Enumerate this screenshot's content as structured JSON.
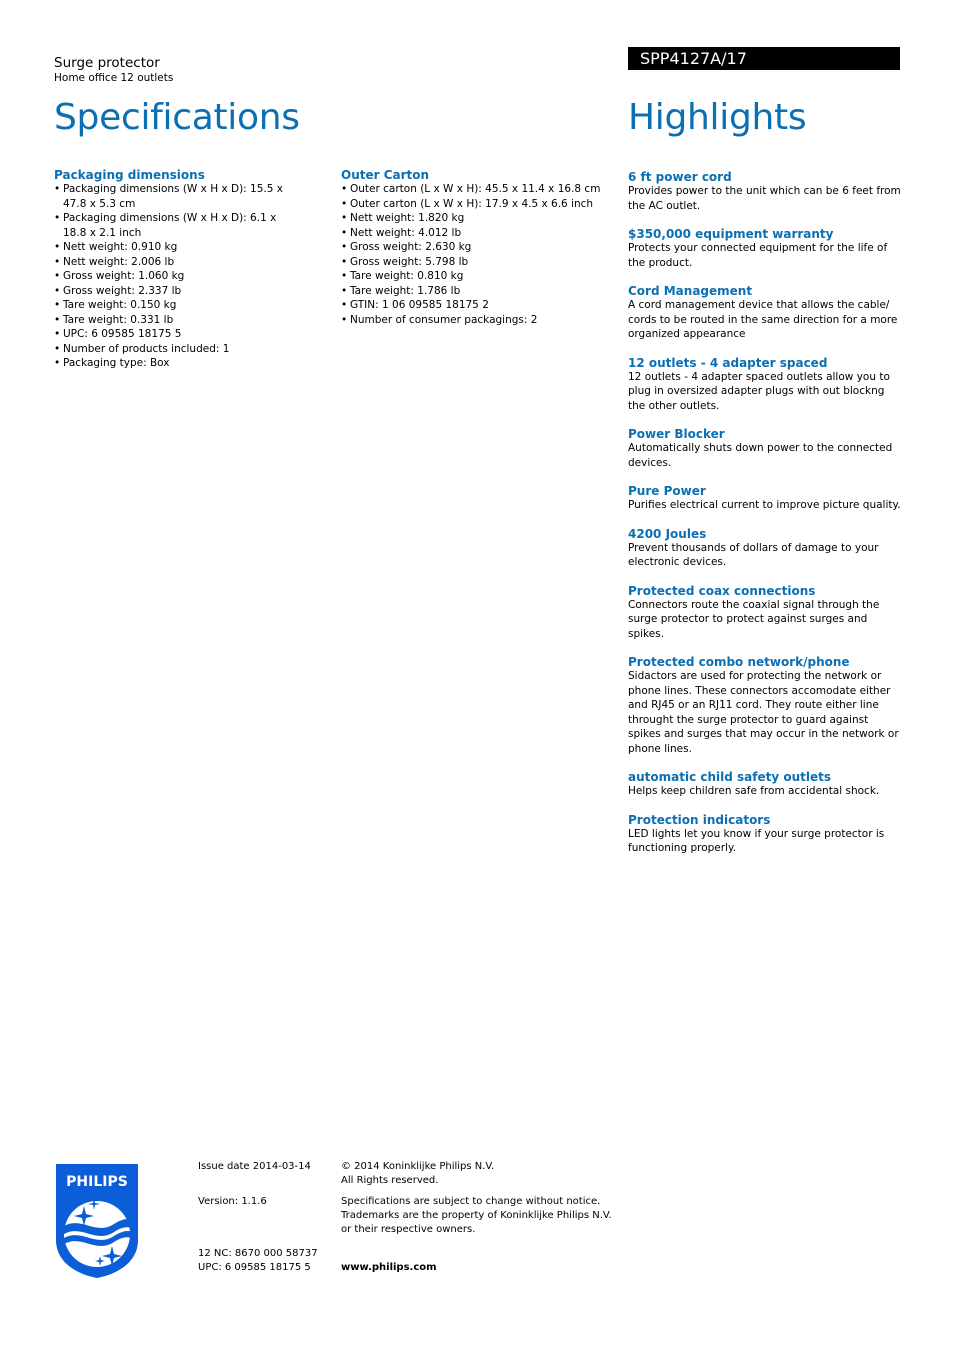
{
  "header": {
    "product_name": "Surge protector",
    "product_sub": "Home office 12 outlets",
    "model": "SPP4127A/17",
    "spec_title": "Specifications",
    "highlights_title": "Highlights"
  },
  "colors": {
    "accent": "#0b6fb3",
    "model_bar": "#000000"
  },
  "specs": {
    "packaging": {
      "title": "Packaging dimensions",
      "items": [
        "Packaging dimensions (W x H x D): 15.5 x 47.8 x 5.3 cm",
        "Packaging dimensions (W x H x D): 6.1 x 18.8 x 2.1 inch",
        "Nett weight: 0.910 kg",
        "Nett weight: 2.006 lb",
        "Gross weight: 1.060 kg",
        "Gross weight: 2.337 lb",
        "Tare weight: 0.150 kg",
        "Tare weight: 0.331 lb",
        "UPC: 6 09585 18175 5",
        "Number of products included: 1",
        "Packaging type: Box"
      ]
    },
    "outer_carton": {
      "title": "Outer Carton",
      "items": [
        "Outer carton (L x W x H): 45.5 x 11.4 x 16.8 cm",
        "Outer carton (L x W x H): 17.9 x 4.5 x 6.6 inch",
        "Nett weight: 1.820 kg",
        "Nett weight: 4.012 lb",
        "Gross weight: 2.630 kg",
        "Gross weight: 5.798 lb",
        "Tare weight: 0.810 kg",
        "Tare weight: 1.786 lb",
        "GTIN: 1 06 09585 18175 2",
        "Number of consumer packagings: 2"
      ]
    }
  },
  "highlights": [
    {
      "title": "6 ft power cord",
      "desc": "Provides power to the unit which can be 6 feet from the AC outlet."
    },
    {
      "title": "$350,000 equipment warranty",
      "desc": "Protects your connected equipment for the life of the product."
    },
    {
      "title": "Cord Management",
      "desc": "A cord management device that allows the cable/ cords to be routed in the same direction for a more organized appearance"
    },
    {
      "title": "12 outlets - 4 adapter spaced",
      "desc": "12 outlets - 4 adapter spaced outlets allow you to plug in oversized adapter plugs with out blockng the other outlets."
    },
    {
      "title": "Power Blocker",
      "desc": "Automatically shuts down power to the connected devices."
    },
    {
      "title": "Pure Power",
      "desc": "Purifies electrical current to improve picture quality."
    },
    {
      "title": "4200 Joules",
      "desc": "Prevent thousands of dollars of damage to your electronic devices."
    },
    {
      "title": "Protected coax connections",
      "desc": "Connectors route the coaxial signal through the surge protector to protect against surges and spikes."
    },
    {
      "title": "Protected combo network/phone",
      "desc": "Sidactors are used for protecting the network or phone lines. These connectors accomodate either and RJ45 or an RJ11 cord. They route either line throught the surge protector to guard against spikes and surges that may occur in the network or phone lines."
    },
    {
      "title": "automatic child safety outlets",
      "desc": "Helps keep children safe from accidental shock."
    },
    {
      "title": "Protection indicators",
      "desc": "LED lights let you know if your surge protector is functioning properly."
    }
  ],
  "footer": {
    "logo_text": "PHILIPS",
    "issue_date": "Issue date 2014-03-14",
    "version": "Version: 1.1.6",
    "nc": "12 NC: 8670 000 58737",
    "upc": "UPC: 6 09585 18175 5",
    "copyright_1": "© 2014 Koninklijke Philips N.V.",
    "copyright_2": "All Rights reserved.",
    "disclaimer_1": "Specifications are subject to change without notice.",
    "disclaimer_2": "Trademarks are the property of Koninklijke Philips N.V.",
    "disclaimer_3": "or their respective owners.",
    "website": "www.philips.com"
  }
}
